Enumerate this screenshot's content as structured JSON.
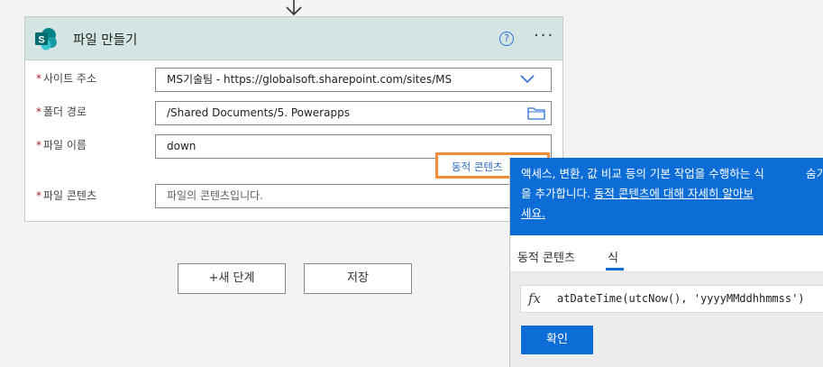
{
  "card": {
    "title": "파일 만들기",
    "help_glyph": "?",
    "more_glyph": "···"
  },
  "fields": [
    {
      "label": "사이트 주소",
      "value": "MS기술팀 - https://globalsoft.sharepoint.com/sites/MS"
    },
    {
      "label": "폴더 경로",
      "value": "/Shared Documents/5. Powerapps"
    },
    {
      "label": "파일 이름",
      "value": "down"
    },
    {
      "label": "파일 콘텐츠",
      "placeholder": "파일의 콘텐츠입니다."
    }
  ],
  "dynamic_content_link": "동적 콘텐츠",
  "buttons": {
    "new_step": "+새 단계",
    "save": "저장"
  },
  "popup": {
    "info_line1": "액세스, 변환, 값 비교 등의 기본 작업을 수행하는 식",
    "info_line2_prefix": "을 추가합니다. ",
    "info_link": "동적 콘텐츠에 대해 자세히 알아보",
    "info_line3": "세요.",
    "hide_label": "숨기",
    "tabs": [
      "동적 콘텐츠",
      "식"
    ],
    "active_tab": "식",
    "fx_label": "fx",
    "expression": "atDateTime(utcNow(), 'yyyyMMddhhmmss')",
    "ok_label": "확인"
  },
  "colors": {
    "accent": "#0c6dd6",
    "highlight_border": "#f28c38",
    "header_bg": "#d4e5e4",
    "required": "#a4262c"
  }
}
